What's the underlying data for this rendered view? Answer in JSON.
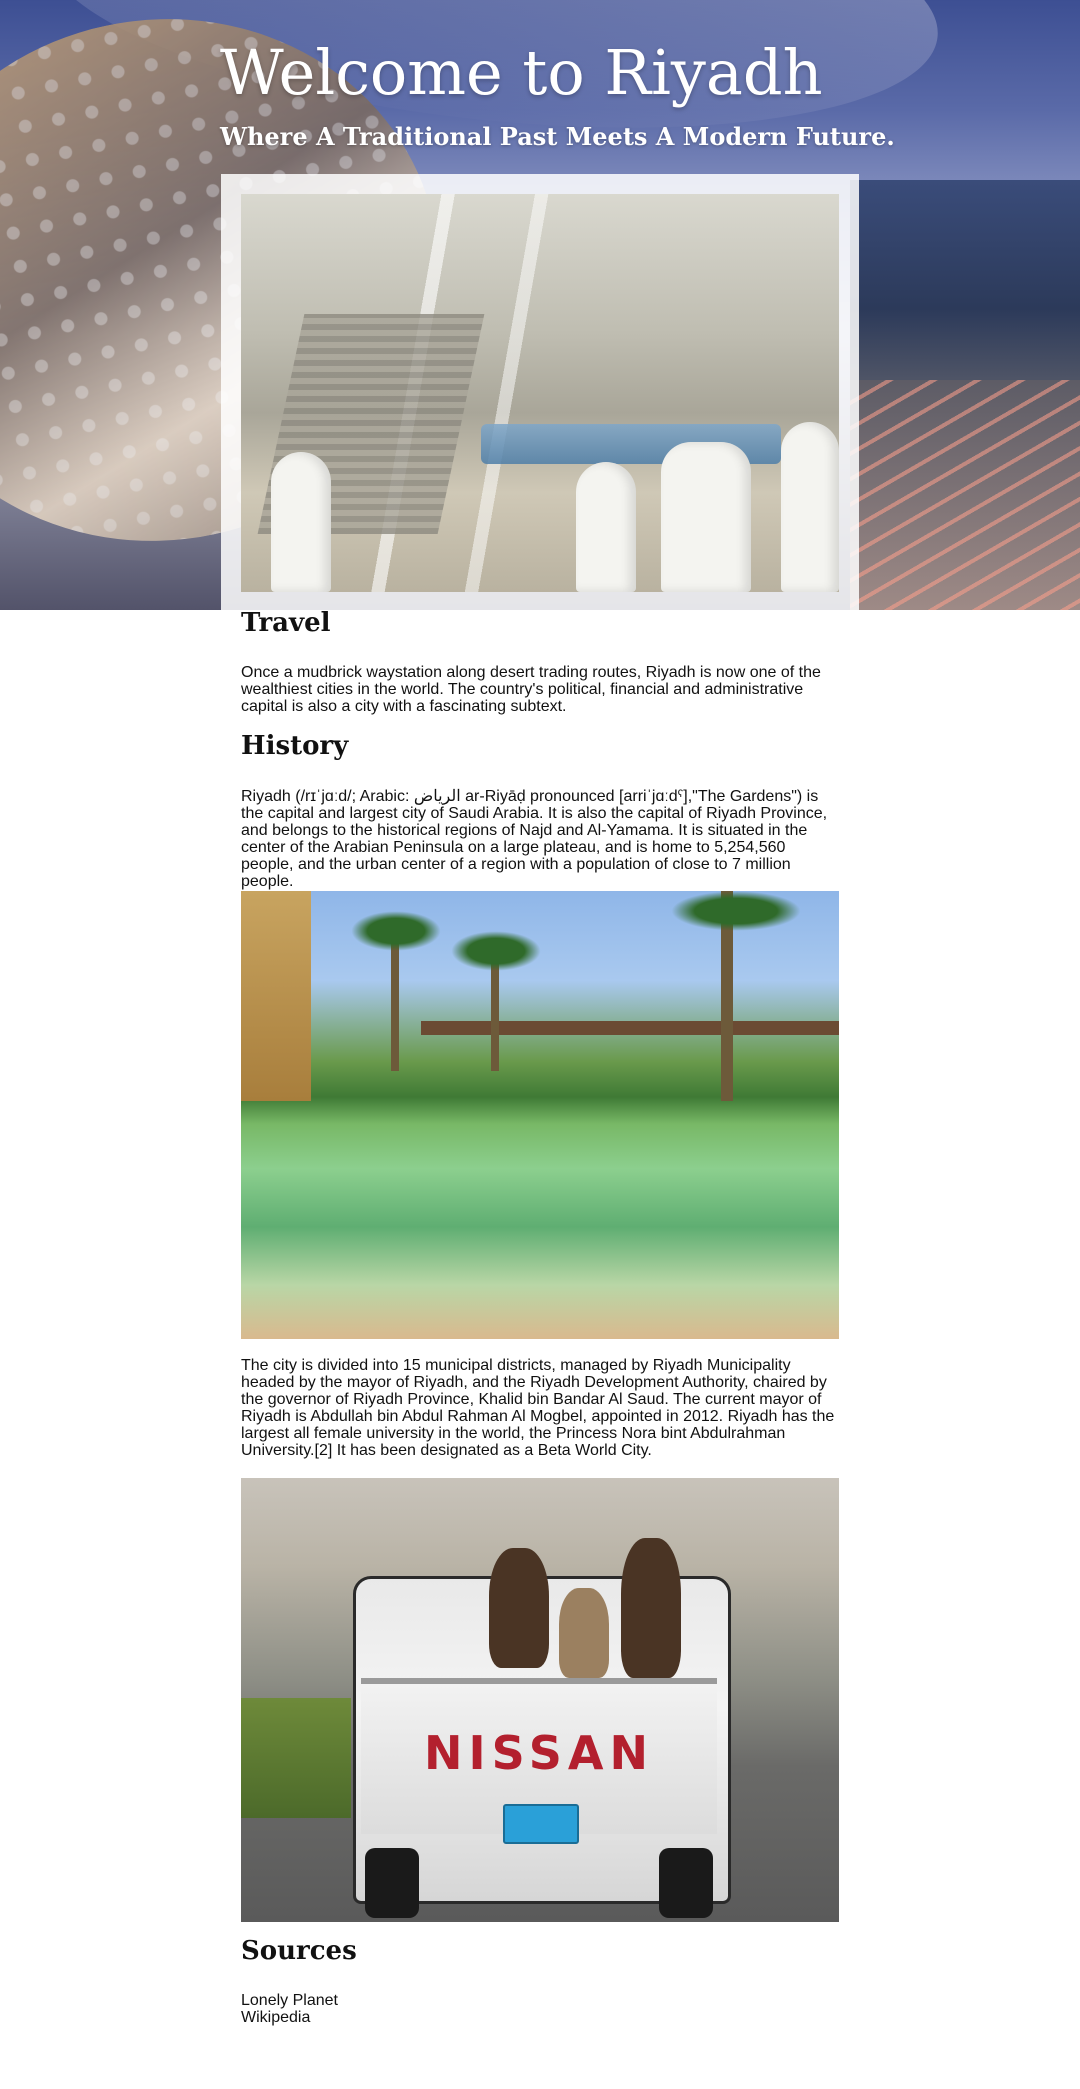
{
  "hero": {
    "title": "Welcome to Riyadh",
    "subtitle": "Where A Traditional Past Meets A Modern Future."
  },
  "sections": {
    "travel": {
      "heading": "Travel",
      "body": "Once a mudbrick waystation along desert trading routes, Riyadh is now one of the wealthiest cities in the world. The country's political, financial and administrative capital is also a city with a fascinating subtext."
    },
    "history": {
      "heading": "History",
      "body": "Riyadh (/rɪˈjɑːd/; Arabic: الرياض ar-Riyāḍ pronounced [arriˈjɑːdˤ],\"The Gardens\") is the capital and largest city of Saudi Arabia. It is also the capital of Riyadh Province, and belongs to the historical regions of Najd and Al-Yamama. It is situated in the center of the Arabian Peninsula on a large plateau, and is home to 5,254,560 people, and the urban center of a region with a population of close to 7 million people.",
      "body2": "The city is divided into 15 municipal districts, managed by Riyadh Municipality headed by the mayor of Riyadh, and the Riyadh Development Authority, chaired by the governor of Riyadh Province, Khalid bin Bandar Al Saud. The current mayor of Riyadh is Abdullah bin Abdul Rahman Al Mogbel, appointed in 2012. Riyadh has the largest all female university in the world, the Princess Nora bint Abdulrahman University.[2] It has been designated as a Beta World City."
    },
    "sources": {
      "heading": "Sources",
      "items": [
        "Lonely Planet",
        "Wikipedia"
      ]
    }
  },
  "images": {
    "truck_brand": "NISSAN"
  },
  "colors": {
    "hero_sky": "#3d4f93",
    "text": "#111111",
    "background": "#ffffff"
  }
}
